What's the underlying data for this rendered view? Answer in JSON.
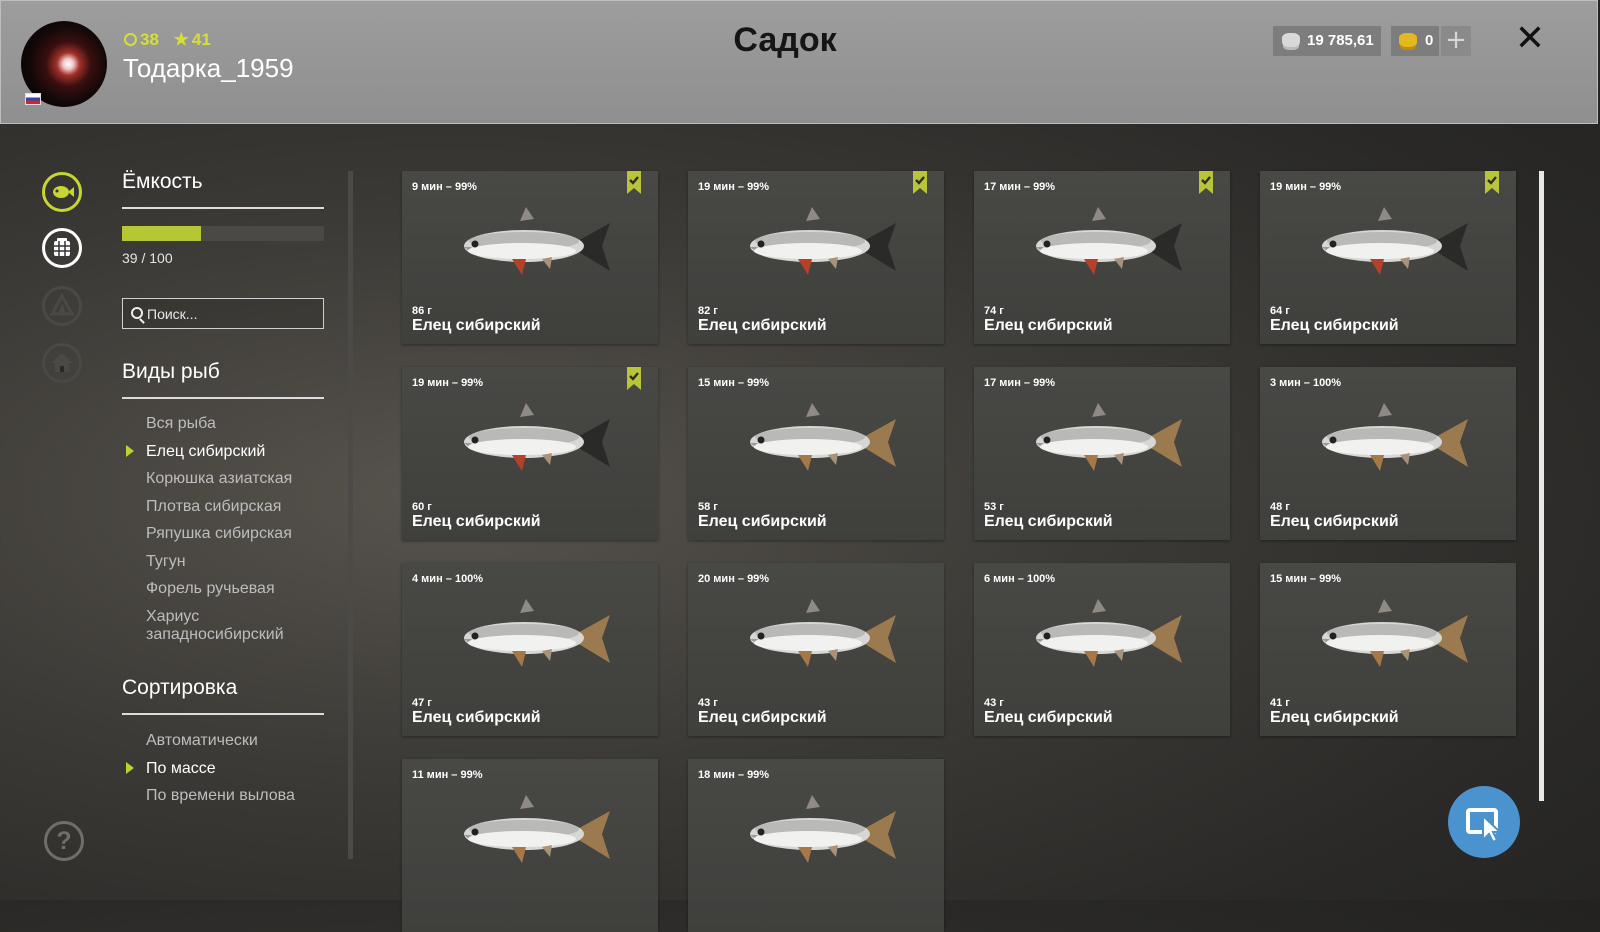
{
  "header": {
    "title": "Садок",
    "username": "Тодарка_1959",
    "level": "38",
    "rank": "41",
    "silver": "19 785,61",
    "gold": "0",
    "plus": "+",
    "close": "✕"
  },
  "nav": {
    "help": "?"
  },
  "capacity": {
    "title": "Ёмкость",
    "current": 39,
    "max": 100,
    "text": "39 / 100"
  },
  "search": {
    "placeholder": "Поиск..."
  },
  "species": {
    "title": "Виды рыб",
    "items": [
      {
        "label": "Вся рыба"
      },
      {
        "label": "Елец сибирский"
      },
      {
        "label": "Корюшка азиатская"
      },
      {
        "label": "Плотва сибирская"
      },
      {
        "label": "Ряпушка сибирская"
      },
      {
        "label": "Тугун"
      },
      {
        "label": "Форель ручьевая"
      },
      {
        "label": "Хариус западносибирский"
      }
    ],
    "selected": "Елец сибирский"
  },
  "sorting": {
    "title": "Сортировка",
    "items": [
      {
        "label": "Автоматически"
      },
      {
        "label": "По массе"
      },
      {
        "label": "По времени вылова"
      }
    ],
    "selected": "По массе"
  },
  "catch": [
    {
      "time": "9 мин – 99%",
      "weight": "86 г",
      "name": "Елец сибирский",
      "tagged": true
    },
    {
      "time": "19 мин – 99%",
      "weight": "82 г",
      "name": "Елец сибирский",
      "tagged": true
    },
    {
      "time": "17 мин – 99%",
      "weight": "74 г",
      "name": "Елец сибирский",
      "tagged": true
    },
    {
      "time": "19 мин – 99%",
      "weight": "64 г",
      "name": "Елец сибирский",
      "tagged": true
    },
    {
      "time": "19 мин – 99%",
      "weight": "60 г",
      "name": "Елец сибирский",
      "tagged": true
    },
    {
      "time": "15 мин – 99%",
      "weight": "58 г",
      "name": "Елец сибирский",
      "tagged": false
    },
    {
      "time": "17 мин – 99%",
      "weight": "53 г",
      "name": "Елец сибирский",
      "tagged": false
    },
    {
      "time": "3 мин – 100%",
      "weight": "48 г",
      "name": "Елец сибирский",
      "tagged": false
    },
    {
      "time": "4 мин – 100%",
      "weight": "47 г",
      "name": "Елец сибирский",
      "tagged": false
    },
    {
      "time": "20 мин – 99%",
      "weight": "43 г",
      "name": "Елец сибирский",
      "tagged": false
    },
    {
      "time": "6 мин – 100%",
      "weight": "43 г",
      "name": "Елец сибирский",
      "tagged": false
    },
    {
      "time": "15 мин – 99%",
      "weight": "41 г",
      "name": "Елец сибирский",
      "tagged": false
    },
    {
      "time": "11 мин – 99%",
      "weight": "",
      "name": "",
      "tagged": false
    },
    {
      "time": "18 мин – 99%",
      "weight": "",
      "name": "",
      "tagged": false
    }
  ],
  "colors": {
    "accent": "#c0d030",
    "header_bg": "#969696",
    "card_bg": "#454542",
    "cursor_button": "#4b93cf"
  }
}
